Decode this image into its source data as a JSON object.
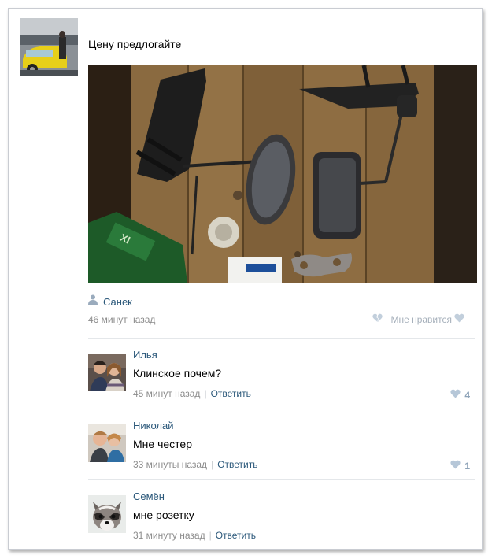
{
  "post": {
    "text": "Цену предлогайте",
    "author": "Санек",
    "time": "46 минут назад",
    "like_label": "Мне нравится"
  },
  "comments": [
    {
      "name": "Илья",
      "text": "Клинское почем?",
      "time": "45 минут назад",
      "reply": "Ответить",
      "likes": "4"
    },
    {
      "name": "Николай",
      "text": "Мне честер",
      "time": "33 минуты назад",
      "reply": "Ответить",
      "likes": "1"
    },
    {
      "name": "Семён",
      "text": "мне розетку",
      "time": "31 минуту назад",
      "reply": "Ответить",
      "likes": ""
    }
  ],
  "colors": {
    "link": "#2b587a",
    "meta": "#8c8c8c",
    "like_icon": "#b6c7d8"
  },
  "icons": {
    "author": "user-icon",
    "like": "heart-icon",
    "dislike": "broken-heart-icon"
  }
}
